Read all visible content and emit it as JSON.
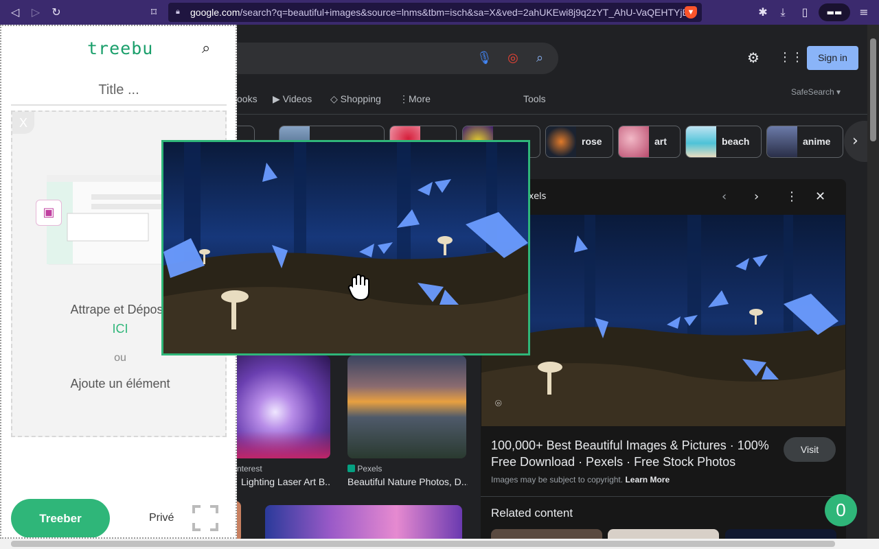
{
  "browser": {
    "url_host": "google.com",
    "url_path": "/search?q=beautiful+images&source=lnms&tbm=isch&sa=X&ved=2ahUKEwi8j9q2zYT_AhU-VaQEHTYjB...",
    "back_icon": "back-icon",
    "forward_icon": "forward-icon",
    "reload_icon": "reload-icon"
  },
  "google": {
    "signin_label": "Sign in",
    "tabs": [
      "ooks",
      "Videos",
      "Shopping",
      "More",
      "Tools"
    ],
    "safesearch": "SafeSearch",
    "chips": [
      {
        "label": ""
      },
      {
        "label": ""
      },
      {
        "label": ""
      },
      {
        "label": "rose"
      },
      {
        "label": "art"
      },
      {
        "label": "beach"
      },
      {
        "label": "anime"
      }
    ],
    "results": [
      {
        "source": "nterest",
        "title": "Lighting Laser Art B..."
      },
      {
        "source": "Pexels",
        "title": "Beautiful Nature Photos, D..."
      }
    ],
    "panel": {
      "source": "exels",
      "title": "100,000+ Best Beautiful Images & Pictures · 100% Free Download · Pexels · Free Stock Photos",
      "visit_label": "Visit",
      "copyright": "Images may be subject to copyright.",
      "learn_more": "Learn More",
      "related": "Related content"
    }
  },
  "treebu": {
    "logo": "treebu",
    "title_placeholder": "Title ...",
    "drop_close": "X",
    "drop_text": "Attrape et Dépose",
    "drop_here": "ICI",
    "or": "ou",
    "add_item": "Ajoute un élément",
    "treeber_label": "Treeber",
    "private_label": "Privé",
    "counter": "0"
  },
  "colors": {
    "treebu_green": "#2fb679",
    "chrome_purple": "#3b2a6e",
    "google_bg": "#202124",
    "signin_blue": "#8ab4f8"
  }
}
